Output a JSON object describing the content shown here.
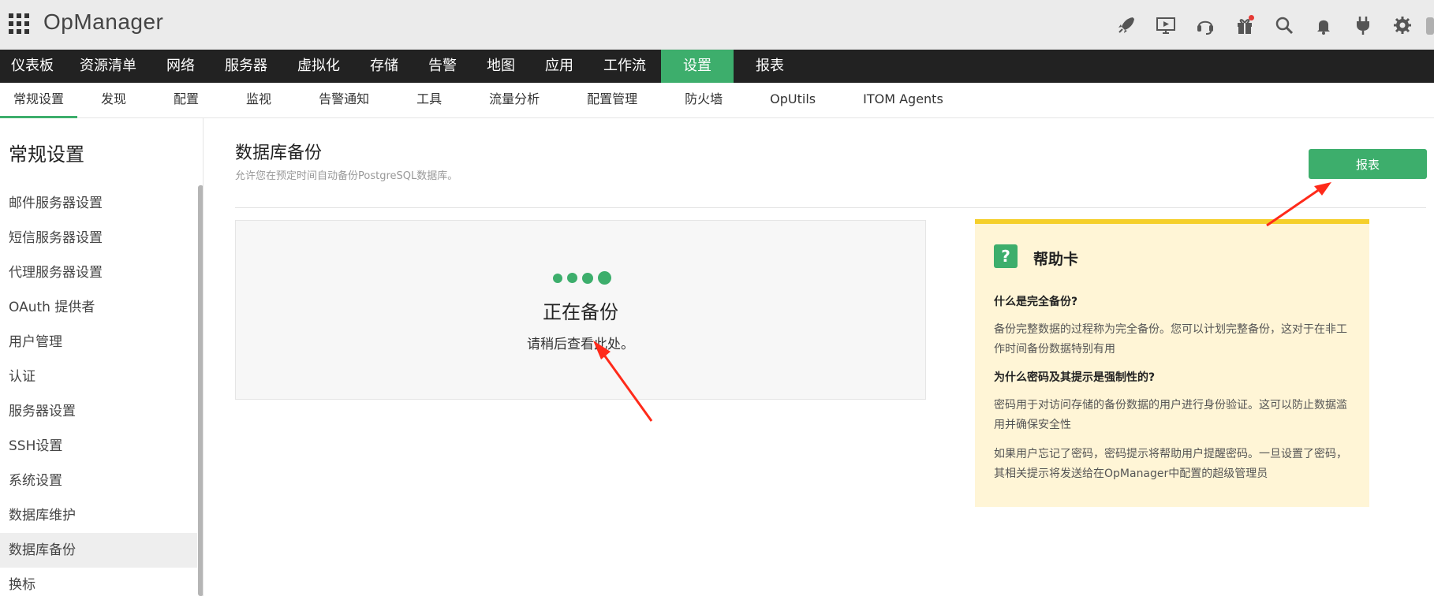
{
  "app": {
    "name": "OpManager"
  },
  "header_icons": [
    {
      "name": "rocket-icon"
    },
    {
      "name": "video-tutorial-icon"
    },
    {
      "name": "headset-support-icon"
    },
    {
      "name": "gift-icon"
    },
    {
      "name": "search-icon"
    },
    {
      "name": "bell-icon"
    },
    {
      "name": "plug-icon"
    },
    {
      "name": "gear-icon"
    }
  ],
  "main_nav": [
    "仪表板",
    "资源清单",
    "网络",
    "服务器",
    "虚拟化",
    "存储",
    "告警",
    "地图",
    "应用",
    "工作流",
    "设置",
    "报表"
  ],
  "main_nav_active": "设置",
  "sub_nav": [
    "常规设置",
    "发现",
    "配置",
    "监视",
    "告警通知",
    "工具",
    "流量分析",
    "配置管理",
    "防火墙",
    "OpUtils",
    "ITOM Agents"
  ],
  "sub_nav_active": "常规设置",
  "sidebar": {
    "title": "常规设置",
    "items": [
      "邮件服务器设置",
      "短信服务器设置",
      "代理服务器设置",
      "OAuth 提供者",
      "用户管理",
      "认证",
      "服务器设置",
      "SSH设置",
      "系统设置",
      "数据库维护",
      "数据库备份",
      "换标"
    ],
    "active": "数据库备份"
  },
  "page": {
    "title": "数据库备份",
    "description": "允许您在预定时间自动备份PostgreSQL数据库。",
    "report_button": "报表"
  },
  "status": {
    "title": "正在备份",
    "message": "请稍后查看此处。"
  },
  "help_card": {
    "title": "帮助卡",
    "icon": "?",
    "q1": "什么是完全备份?",
    "a1": "备份完整数据的过程称为完全备份。您可以计划完整备份，这对于在非工作时间备份数据特别有用",
    "q2": "为什么密码及其提示是强制性的?",
    "a2": "密码用于对访问存储的备份数据的用户进行身份验证。这可以防止数据滥用并确保安全性",
    "a3": "如果用户忘记了密码，密码提示将帮助用户提醒密码。一旦设置了密码，其相关提示将发送给在OpManager中配置的超级管理员"
  },
  "colors": {
    "accent_green": "#3dae6c",
    "nav_dark": "#222222",
    "help_bg": "#fff5d6",
    "help_border": "#f5cf2a",
    "annotation_red": "#ff2a1a"
  }
}
